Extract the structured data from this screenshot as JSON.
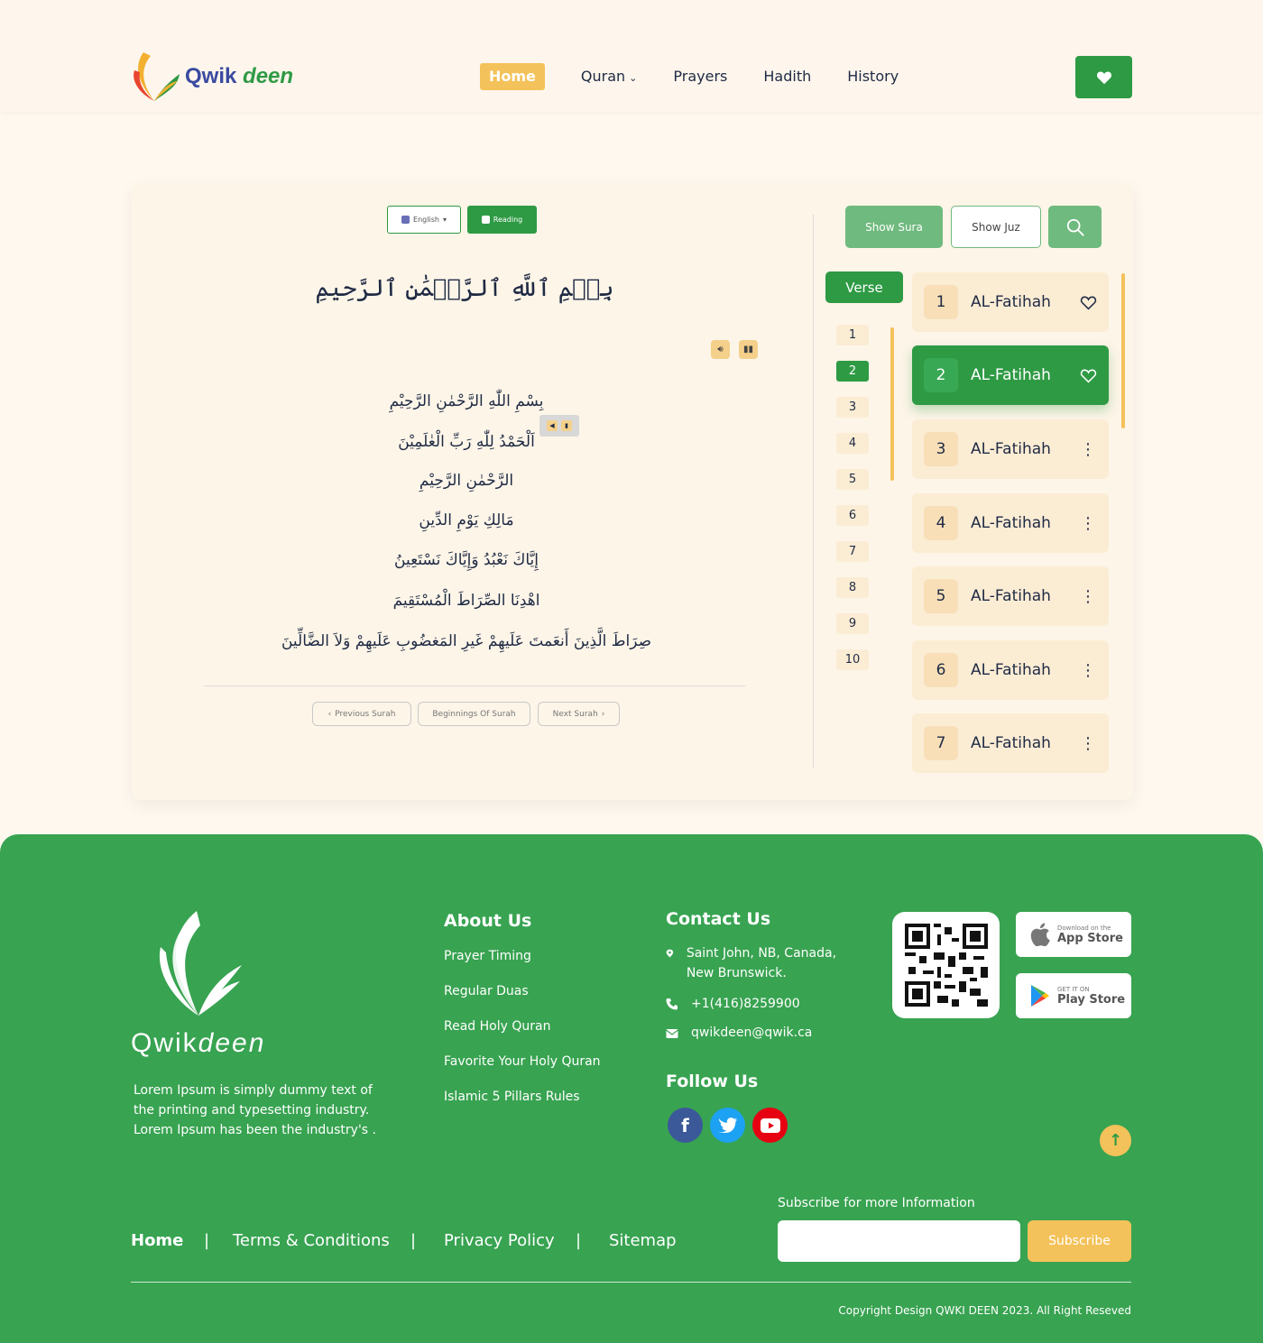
{
  "header": {
    "logo_text_a": "Qwik",
    "logo_text_b": "deen",
    "nav": [
      {
        "label": "Home",
        "active": true
      },
      {
        "label": "Quran",
        "has_dropdown": true
      },
      {
        "label": "Prayers"
      },
      {
        "label": "Hadith"
      },
      {
        "label": "History"
      }
    ],
    "favorite_icon": "heart-icon"
  },
  "reader": {
    "language": "English",
    "mode": "Reading",
    "title_arabic": "بِسۡمِ ٱللَّهِ ٱلرَّحۡمَٰنِ ٱلرَّحِيمِ",
    "verses": [
      "بِسْمِ اللّٰهِ الرَّحْمٰنِ الرَّحِيْمِ",
      "اَلْحَمْدُ لِلّٰهِ رَبِّ الْعٰلَمِيْنَ",
      "الرَّحْمٰنِ الرَّحِيْمِ",
      "مَالِكِ يَوْمِ الدِّينِ",
      "إِيَّاكَ نَعْبُدُ وَإِيَّاكَ نَسْتَعِينُ",
      "اهْدِنَا الصِّرَاطَ الْمُسْتَقِيمَ",
      "صِرَاطَ الَّذِينَ أَنعَمتَ عَلَيهِمْ غَيرِ المَغضُوبِ عَلَيهِمْ وَلاَ الضَّالِّينَ"
    ],
    "prev_label": "Previous Surah",
    "begin_label": "Beginnings Of Surah",
    "next_label": "Next Surah"
  },
  "panel": {
    "show_sura": "Show Sura",
    "show_juz": "Show Juz",
    "verse_tab": "Verse",
    "verse_numbers": [
      "1",
      "2",
      "3",
      "4",
      "5",
      "6",
      "7",
      "8",
      "9",
      "10"
    ],
    "active_verse": "2",
    "suras": [
      {
        "num": "1",
        "name": "AL-Fatihah",
        "action": "heart"
      },
      {
        "num": "2",
        "name": "AL-Fatihah",
        "action": "heart",
        "active": true
      },
      {
        "num": "3",
        "name": "AL-Fatihah",
        "action": "more"
      },
      {
        "num": "4",
        "name": "AL-Fatihah",
        "action": "more"
      },
      {
        "num": "5",
        "name": "AL-Fatihah",
        "action": "more"
      },
      {
        "num": "6",
        "name": "AL-Fatihah",
        "action": "more"
      },
      {
        "num": "7",
        "name": "AL-Fatihah",
        "action": "more"
      }
    ]
  },
  "footer": {
    "brand_a": "Qwik",
    "brand_b": "deen",
    "description": "Lorem Ipsum is simply dummy text of the printing and typesetting industry.  Lorem Ipsum has been the industry's .",
    "about_heading": "About Us",
    "about_links": [
      "Prayer Timing",
      "Regular Duas",
      "Read Holy Quran",
      "Favorite Your Holy Quran",
      "Islamic 5 Pillars Rules"
    ],
    "contact_heading": "Contact Us",
    "address": "Saint John, NB, Canada, New Brunswick.",
    "phone": "+1(416)8259900",
    "email": "qwikdeen@qwik.ca",
    "follow_heading": "Follow Us",
    "app_store_small": "Download on the",
    "app_store_big": "App Store",
    "play_store_small": "GET IT ON",
    "play_store_big": "Play Store",
    "bottom_links": [
      "Home",
      "Terms & Conditions",
      "Privacy Policy",
      "Sitemap"
    ],
    "subscribe_label": "Subscribe for more Information",
    "subscribe_button": "Subscribe",
    "copyright": "Copyright Design QWKI DEEN 2023.  All Right Reseved"
  },
  "colors": {
    "brand_green": "#2e9a44",
    "footer_green": "#38a351",
    "accent_yellow": "#f4c25a",
    "card_cream": "#fbecd4"
  }
}
